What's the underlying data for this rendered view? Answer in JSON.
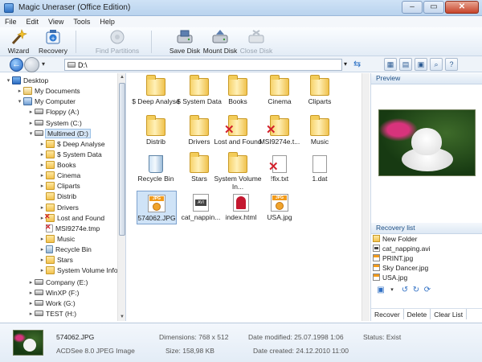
{
  "window": {
    "title": "Magic Uneraser (Office Edition)"
  },
  "menu": [
    "File",
    "Edit",
    "View",
    "Tools",
    "Help"
  ],
  "toolbar": {
    "wizard": "Wizard",
    "recovery": "Recovery",
    "find_partitions": "Find Partitions",
    "save_disk": "Save Disk",
    "mount_disk": "Mount Disk",
    "close_disk": "Close Disk"
  },
  "address": {
    "path": "D:\\"
  },
  "tree": [
    {
      "label": "Desktop",
      "icon": "desktop"
    },
    {
      "label": "My Documents",
      "icon": "docs"
    },
    {
      "label": "My Computer",
      "icon": "comp"
    },
    {
      "label": "Floppy (A:)",
      "icon": "drive"
    },
    {
      "label": "System (C:)",
      "icon": "drive"
    },
    {
      "label": "Multimed (D:)",
      "icon": "drive"
    },
    {
      "label": "$ Deep Analyse",
      "icon": "folder"
    },
    {
      "label": "$ System Data",
      "icon": "folder"
    },
    {
      "label": "Books",
      "icon": "folder"
    },
    {
      "label": "Cinema",
      "icon": "folder"
    },
    {
      "label": "Cliparts",
      "icon": "folder"
    },
    {
      "label": "Distrib",
      "icon": "folder"
    },
    {
      "label": "Drivers",
      "icon": "folder"
    },
    {
      "label": "Lost and Found",
      "icon": "folder-x"
    },
    {
      "label": "MSI9274e.tmp",
      "icon": "file-x"
    },
    {
      "label": "Music",
      "icon": "folder"
    },
    {
      "label": "Recycle Bin",
      "icon": "bin"
    },
    {
      "label": "Stars",
      "icon": "folder"
    },
    {
      "label": "System Volume Infor",
      "icon": "folder"
    },
    {
      "label": "Company (E:)",
      "icon": "drive"
    },
    {
      "label": "WinXP (F:)",
      "icon": "drive"
    },
    {
      "label": "Work (G:)",
      "icon": "drive"
    },
    {
      "label": "TEST (H:)",
      "icon": "drive"
    }
  ],
  "files": [
    {
      "label": "$ Deep Analyse",
      "icon": "folder"
    },
    {
      "label": "$ System Data",
      "icon": "folder"
    },
    {
      "label": "Books",
      "icon": "folder"
    },
    {
      "label": "Cinema",
      "icon": "folder"
    },
    {
      "label": "Cliparts",
      "icon": "folder"
    },
    {
      "label": "Distrib",
      "icon": "folder"
    },
    {
      "label": "Drivers",
      "icon": "folder"
    },
    {
      "label": "Lost and Found",
      "icon": "folder-x"
    },
    {
      "label": "MSI9274e.t...",
      "icon": "folder-x"
    },
    {
      "label": "Music",
      "icon": "folder"
    },
    {
      "label": "Recycle Bin",
      "icon": "bin"
    },
    {
      "label": "Stars",
      "icon": "folder"
    },
    {
      "label": "System Volume In...",
      "icon": "folder"
    },
    {
      "label": "!fix.txt",
      "icon": "doc-x"
    },
    {
      "label": "1.dat",
      "icon": "doc"
    },
    {
      "label": "574062.JPG",
      "icon": "jpg"
    },
    {
      "label": "cat_nappin...",
      "icon": "avi"
    },
    {
      "label": "index.html",
      "icon": "html"
    },
    {
      "label": "USA.jpg",
      "icon": "jpg"
    }
  ],
  "preview": {
    "title": "Preview"
  },
  "recovery_list": {
    "title": "Recovery list",
    "items": [
      {
        "label": "New Folder",
        "icon": "folder"
      },
      {
        "label": "cat_napping.avi",
        "icon": "avi"
      },
      {
        "label": "PRINT.jpg",
        "icon": "jpg"
      },
      {
        "label": "Sky Dancer.jpg",
        "icon": "jpg"
      },
      {
        "label": "USA.jpg",
        "icon": "jpg"
      }
    ],
    "actions": {
      "recover": "Recover",
      "delete": "Delete",
      "clear": "Clear List"
    }
  },
  "status": {
    "filename": "574062.JPG",
    "filetype": "ACDSee 8.0 JPEG Image",
    "dimensions": "Dimensions: 768 x 512",
    "size": "Size: 158,98 KB",
    "modified": "Date modified: 25.07.1998 1:06",
    "created": "Date created: 24.12.2010 11:00",
    "status": "Status: Exist"
  }
}
